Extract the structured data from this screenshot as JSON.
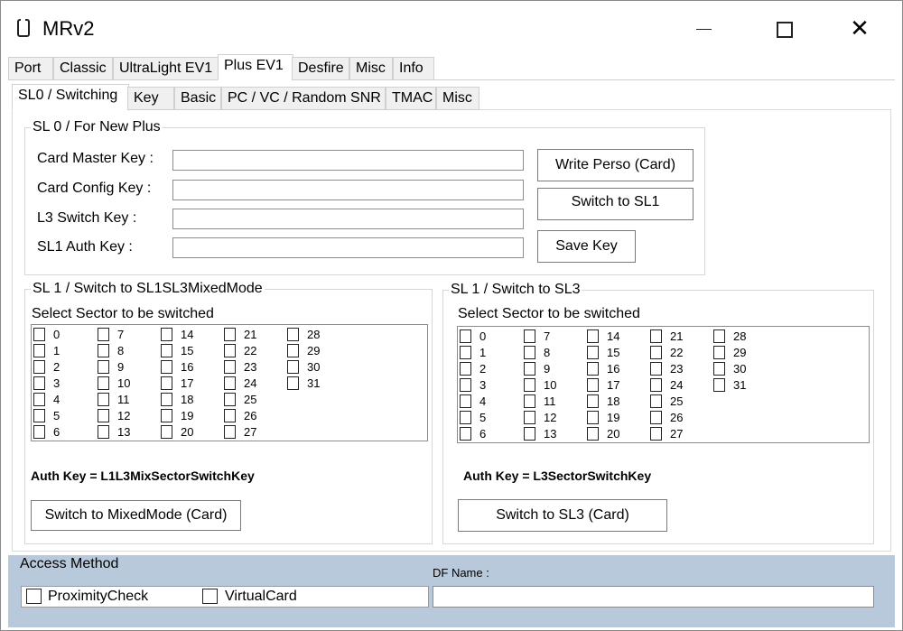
{
  "window": {
    "title": "MRv2",
    "icon": "card-icon",
    "controls": [
      "minimize",
      "maximize",
      "close"
    ]
  },
  "tabs_top": [
    "Port",
    "Classic",
    "UltraLight EV1",
    "Plus EV1",
    "Desfire",
    "Misc",
    "Info"
  ],
  "tabs_top_active": "Plus EV1",
  "tabs_sub": [
    "SL0 / Switching",
    "Key",
    "Basic",
    "PC / VC / Random SNR",
    "TMAC",
    "Misc"
  ],
  "tabs_sub_active": "SL0 / Switching",
  "sl0": {
    "group_label": "SL 0 / For New Plus",
    "labels": {
      "card_master_key": "Card Master Key :",
      "card_config_key": "Card Config Key :",
      "l3_switch_key": "L3 Switch Key :",
      "sl1_auth_key": "SL1 Auth Key :"
    },
    "values": {
      "card_master_key": "",
      "card_config_key": "",
      "l3_switch_key": "",
      "sl1_auth_key": ""
    },
    "buttons": {
      "write_perso": "Write Perso (Card)",
      "switch_sl1": "Switch to SL1",
      "save_key": "Save Key"
    }
  },
  "sl1_mixed": {
    "group_label": "SL 1 / Switch to SL1SL3MixedMode",
    "select_label": "Select Sector to be switched",
    "auth_key": "Auth Key = L1L3MixSectorSwitchKey",
    "button": "Switch to MixedMode (Card)"
  },
  "sl1_sl3": {
    "group_label": "SL 1 / Switch to SL3",
    "select_label": "Select Sector to be switched",
    "auth_key": "Auth Key = L3SectorSwitchKey",
    "button": "Switch to SL3 (Card)"
  },
  "sectors": [
    [
      0,
      1,
      2,
      3,
      4,
      5,
      6
    ],
    [
      7,
      8,
      9,
      10,
      11,
      12,
      13
    ],
    [
      14,
      15,
      16,
      17,
      18,
      19,
      20
    ],
    [
      21,
      22,
      23,
      24,
      25,
      26,
      27
    ],
    [
      28,
      29,
      30,
      31
    ]
  ],
  "access": {
    "label": "Access Method",
    "proximity_check": "ProximityCheck",
    "proximity_check_checked": false,
    "virtual_card": "VirtualCard",
    "virtual_card_checked": false,
    "df_name_label": "DF Name :",
    "df_name_value": ""
  },
  "colors": {
    "access_panel_bg": "#b9c9dc",
    "window_bg": "#ffffff",
    "tab_bg": "#f0f0f0"
  }
}
